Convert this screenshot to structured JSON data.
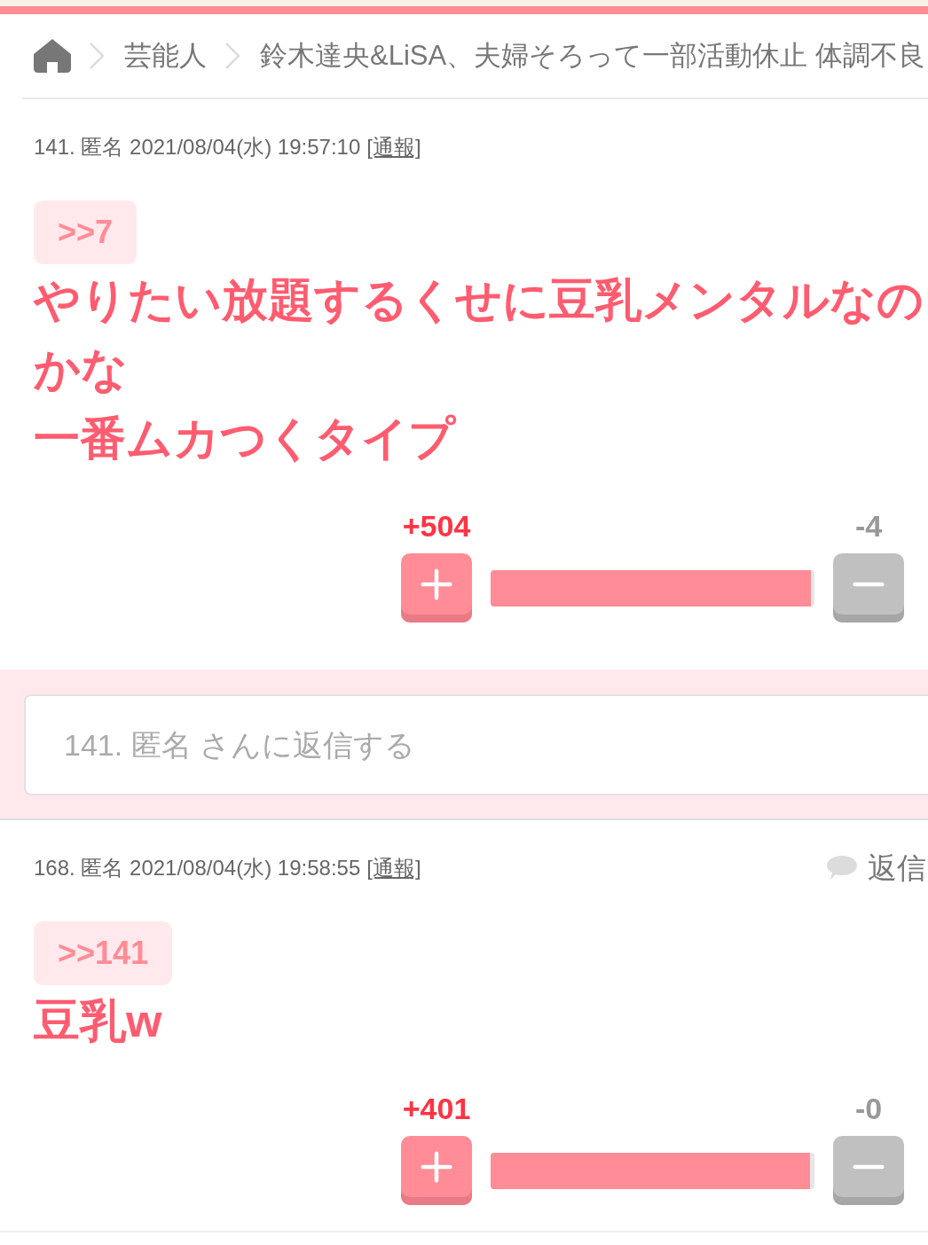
{
  "breadcrumb": {
    "items": [
      {
        "label": "芸能人"
      },
      {
        "label": "鈴木達央&LiSA、夫婦そろって一部活動休止 体調不良"
      }
    ]
  },
  "comments": [
    {
      "meta": "141. 匿名 2021/08/04(水) 19:57:10",
      "report_link": "[通報]",
      "anchor": ">>7",
      "body": [
        "やりたい放題するくせに豆乳メンタルなのかな",
        "一番ムカつくタイプ"
      ],
      "votes": {
        "plus": "+504",
        "minus": "-4",
        "level": 0.99
      },
      "reply_box": {
        "placeholder": "141. 匿名 さんに返信する"
      }
    },
    {
      "meta": "168. 匿名 2021/08/04(水) 19:58:55",
      "report_link": "[通報]",
      "reply_link": "返信",
      "anchor": ">>141",
      "body": [
        "豆乳w"
      ],
      "votes": {
        "plus": "+401",
        "minus": "-0",
        "level": 0.985
      }
    }
  ]
}
